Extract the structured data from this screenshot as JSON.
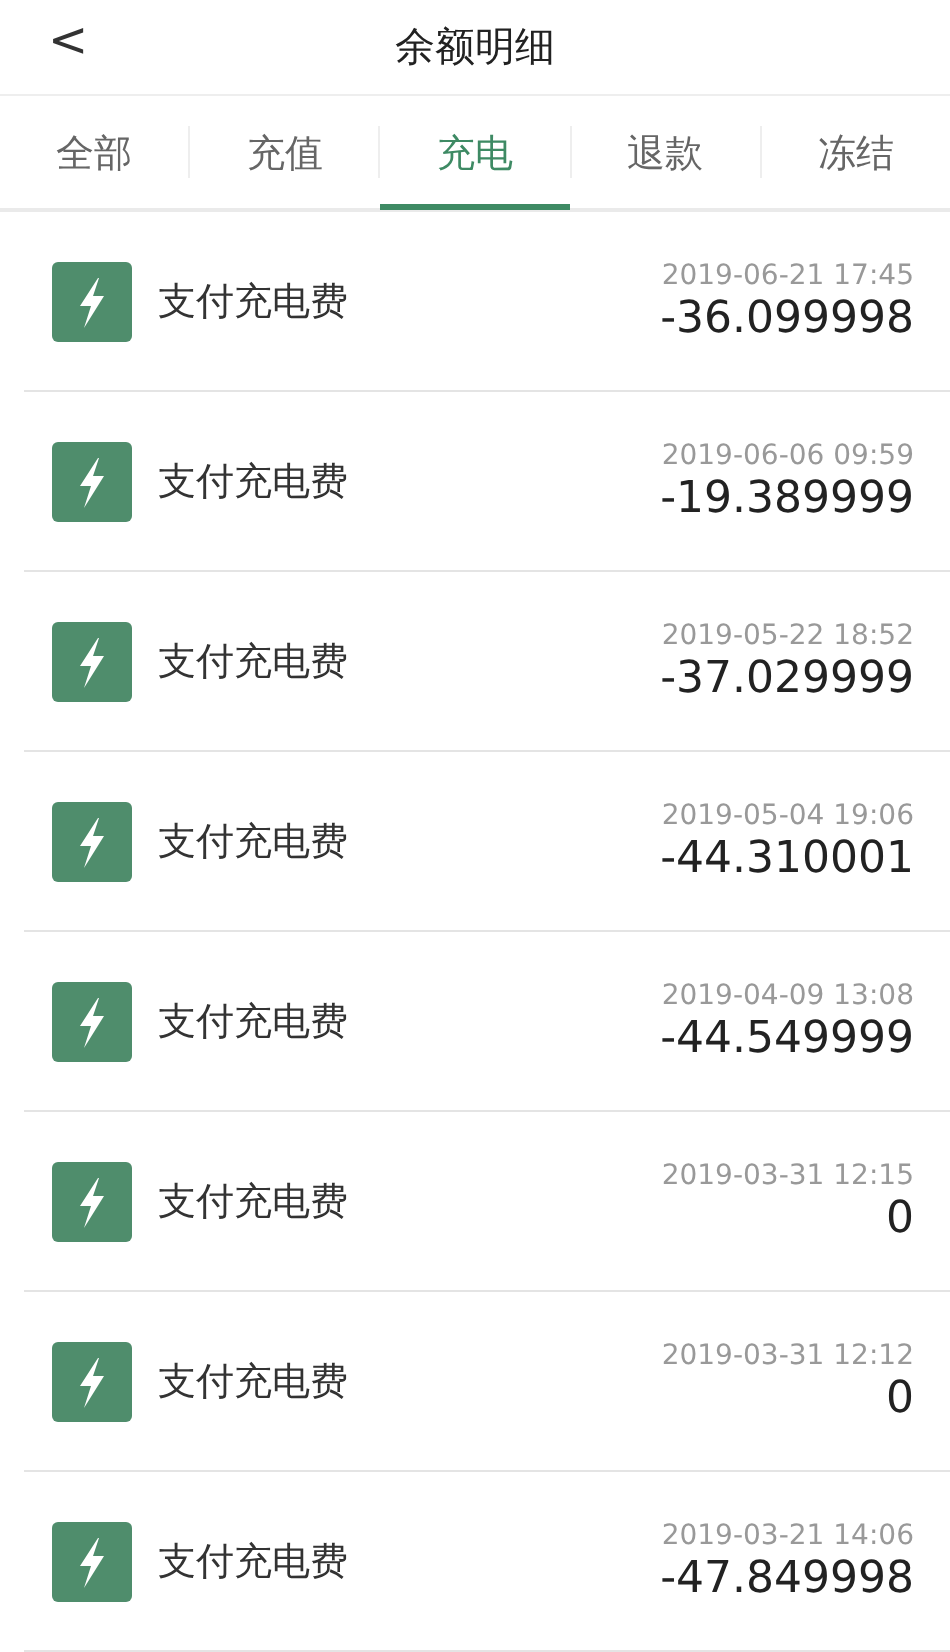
{
  "header": {
    "back": "<",
    "title": "余额明细"
  },
  "tabs": [
    {
      "label": "全部",
      "selected": false
    },
    {
      "label": "充值",
      "selected": false
    },
    {
      "label": "充电",
      "selected": true
    },
    {
      "label": "退款",
      "selected": false
    },
    {
      "label": "冻结",
      "selected": false
    }
  ],
  "records": [
    {
      "title": "支付充电费",
      "time": "2019-06-21 17:45",
      "amount": "-36.099998"
    },
    {
      "title": "支付充电费",
      "time": "2019-06-06 09:59",
      "amount": "-19.389999"
    },
    {
      "title": "支付充电费",
      "time": "2019-05-22 18:52",
      "amount": "-37.029999"
    },
    {
      "title": "支付充电费",
      "time": "2019-05-04 19:06",
      "amount": "-44.310001"
    },
    {
      "title": "支付充电费",
      "time": "2019-04-09 13:08",
      "amount": "-44.549999"
    },
    {
      "title": "支付充电费",
      "time": "2019-03-31 12:15",
      "amount": "0"
    },
    {
      "title": "支付充电费",
      "time": "2019-03-31 12:12",
      "amount": "0"
    },
    {
      "title": "支付充电费",
      "time": "2019-03-21 14:06",
      "amount": "-47.849998"
    }
  ]
}
